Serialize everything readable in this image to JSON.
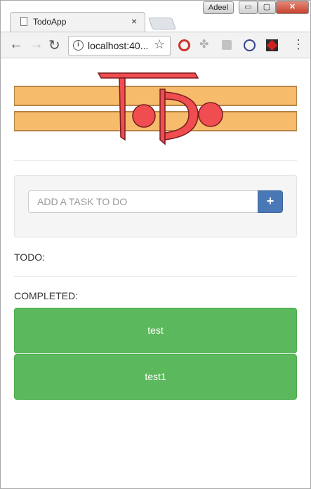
{
  "browser": {
    "tab_title": "TodoApp",
    "tab_close": "×",
    "user_badge": "Adeel",
    "window_buttons": {
      "minimize": "▭",
      "maximize": "▢",
      "close": "✕"
    },
    "url": "localhost:40...",
    "info_icon": "i",
    "icons": [
      "page-icon",
      "back-icon",
      "forward-icon",
      "reload-icon",
      "info-icon",
      "star-icon",
      "opera-icon",
      "puzzle-icon",
      "camera-icon",
      "block-icon",
      "pdf-icon",
      "menu-icon"
    ]
  },
  "app": {
    "logo_text": "ToDo",
    "colors": {
      "band": "#f6bb6b",
      "band_border": "#b58447",
      "letter_fill": "#f04d51",
      "letter_stroke": "#7a1d1f"
    },
    "input_placeholder": "ADD A TASK TO DO",
    "add_button_icon": "+",
    "todo_label": "TODO:",
    "completed_label": "COMPLETED:",
    "completed_tasks": [
      "test",
      "test1"
    ],
    "card_color": "#5cb85c"
  }
}
